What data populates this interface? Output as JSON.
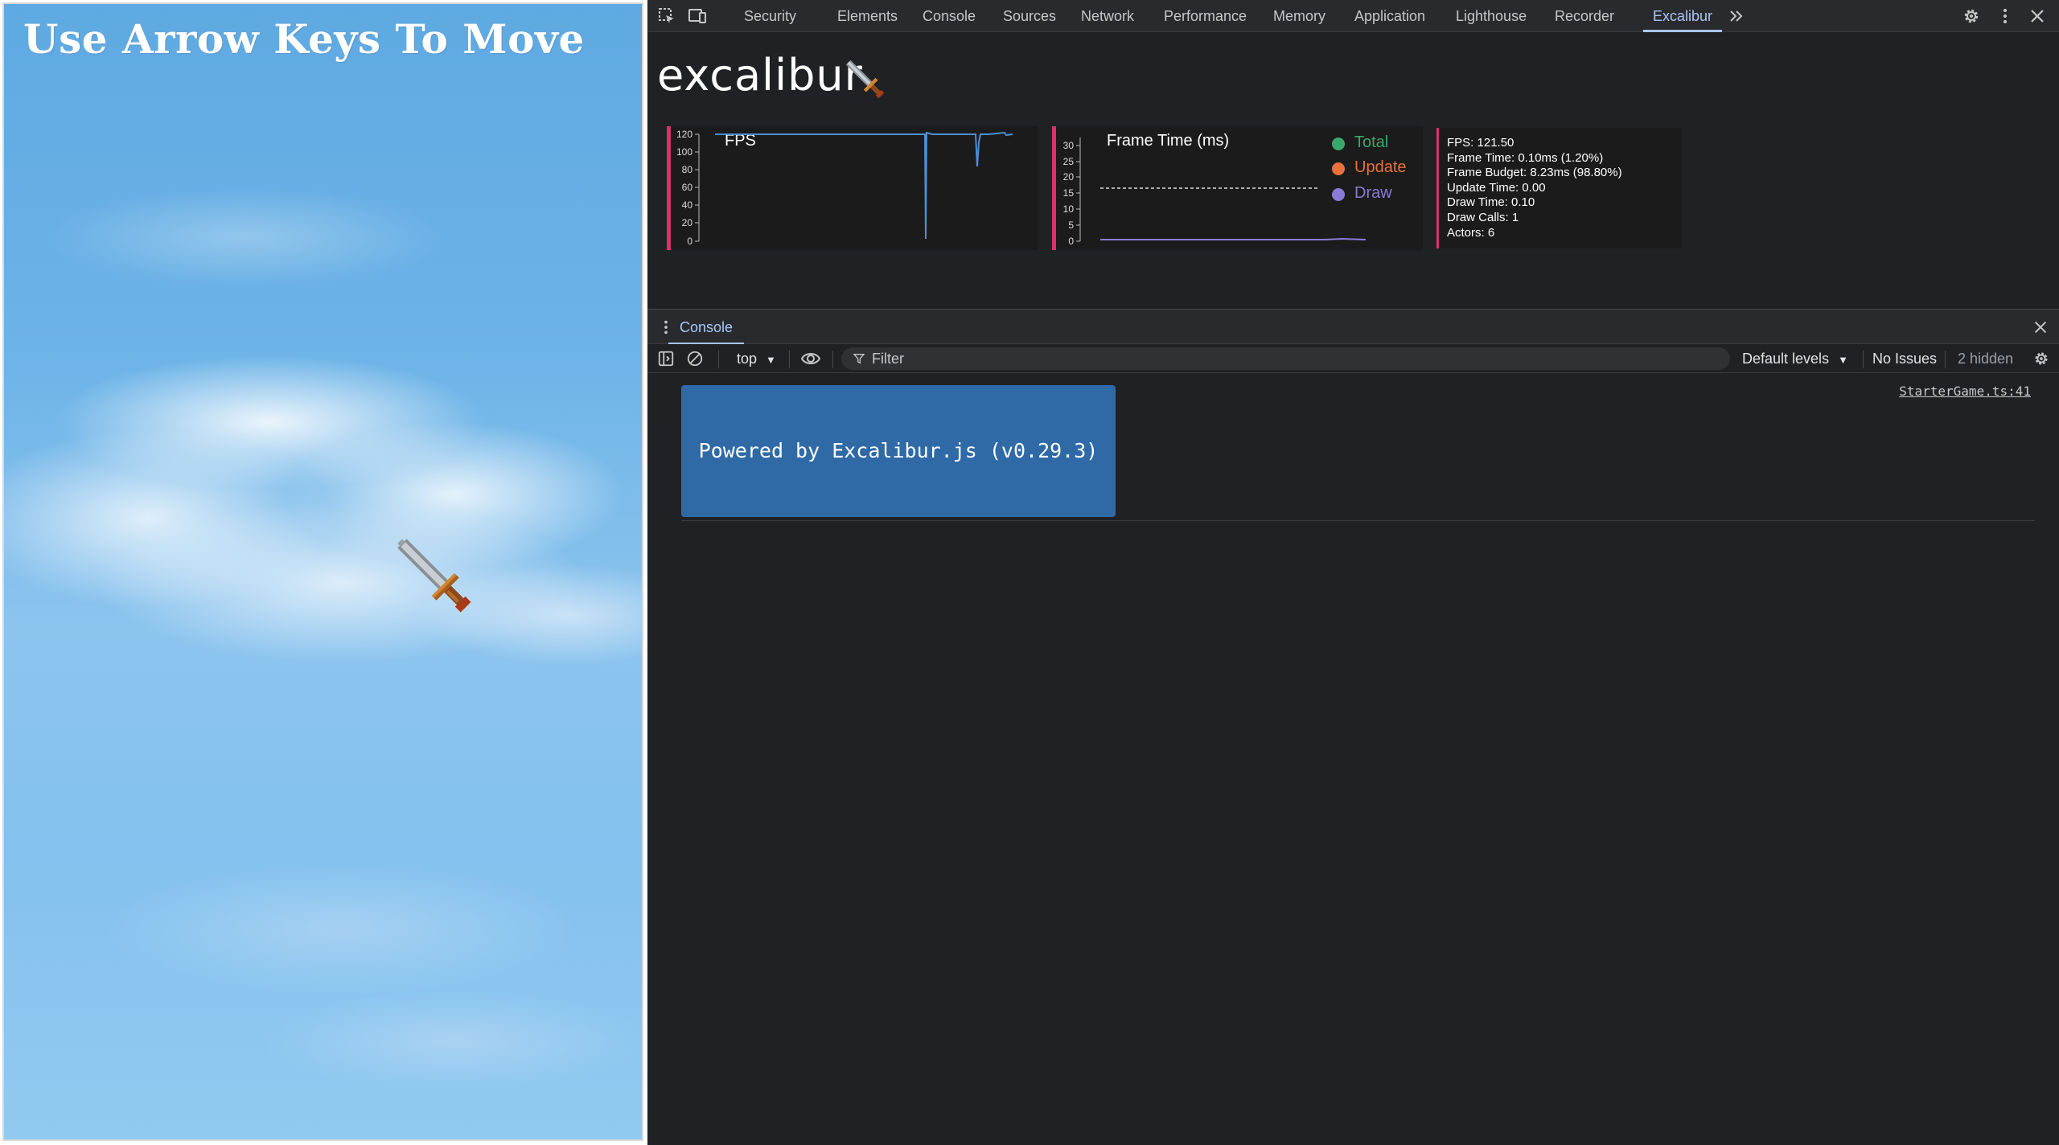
{
  "game": {
    "title": "Use Arrow Keys To Move"
  },
  "devtools": {
    "tabs": [
      "Security",
      "Elements",
      "Console",
      "Sources",
      "Network",
      "Performance",
      "Memory",
      "Application",
      "Lighthouse",
      "Recorder",
      "Excalibur"
    ],
    "active_tab": "Excalibur",
    "more_tabs_icon": "double-chevron-right-icon",
    "right_icons": [
      "gear-icon",
      "kebab-menu-icon",
      "close-icon"
    ]
  },
  "excalibur": {
    "logo_text": "excalibur",
    "accent_color": "#d6336c",
    "fps_graph": {
      "title": "FPS",
      "ticks": [
        "120",
        "100",
        "80",
        "60",
        "40",
        "20",
        "0"
      ]
    },
    "frame_time_graph": {
      "title": "Frame Time (ms)",
      "ticks": [
        "30",
        "25",
        "20",
        "15",
        "10",
        "5",
        "0"
      ],
      "legend": [
        {
          "label": "Total",
          "color": "#3aa76d"
        },
        {
          "label": "Update",
          "color": "#e8713c"
        },
        {
          "label": "Draw",
          "color": "#8a7bd6"
        }
      ]
    },
    "stats": {
      "fps": "FPS: 121.50",
      "frame_time": "Frame Time: 0.10ms (1.20%)",
      "frame_budget": "Frame Budget: 8.23ms (98.80%)",
      "update_time": "Update Time: 0.00",
      "draw_time": "Draw Time: 0.10",
      "draw_calls": "Draw Calls: 1",
      "actors": "Actors: 6"
    }
  },
  "drawer": {
    "tab": "Console",
    "close_icon": "close-icon"
  },
  "console": {
    "context": "top",
    "filter_placeholder": "Filter",
    "levels": "Default levels",
    "issues": "No Issues",
    "hidden": "2 hidden",
    "log_message": "Powered by Excalibur.js (v0.29.3)",
    "log_source": "StarterGame.ts:41"
  }
}
